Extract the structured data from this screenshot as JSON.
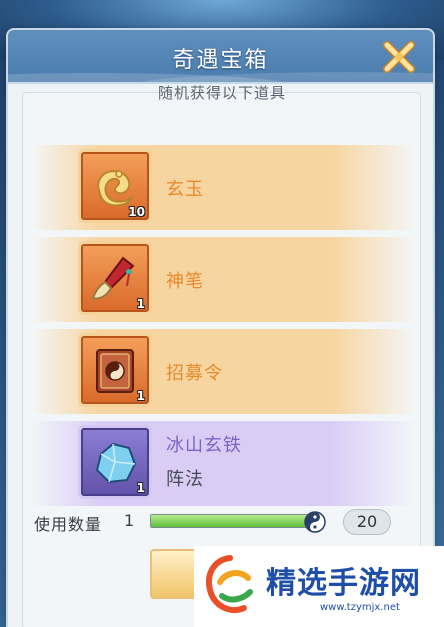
{
  "dialog": {
    "title": "奇遇宝箱",
    "subtitle": "随机获得以下道具"
  },
  "items": [
    {
      "name": "玄玉",
      "quantity": "10",
      "rarity": "orange",
      "icon": "jade-icon"
    },
    {
      "name": "神笔",
      "quantity": "1",
      "rarity": "orange",
      "icon": "brush-icon"
    },
    {
      "name": "招募令",
      "quantity": "1",
      "rarity": "orange",
      "icon": "recruit-book-icon"
    },
    {
      "name": "冰山玄铁",
      "sub_label": "阵法",
      "quantity": "1",
      "rarity": "purple",
      "icon": "ice-iron-icon"
    }
  ],
  "use_quantity": {
    "label": "使用数量",
    "value": "1",
    "max": "20",
    "slider_fraction": 1.0
  },
  "watermark": {
    "text": "精选手游网",
    "url": "www.tzymjx.net"
  },
  "colors": {
    "orange_text": "#e88a2c",
    "purple_text": "#7d63c9",
    "header": "#5f8fbd",
    "slider_fill": "#5fbf3b"
  }
}
